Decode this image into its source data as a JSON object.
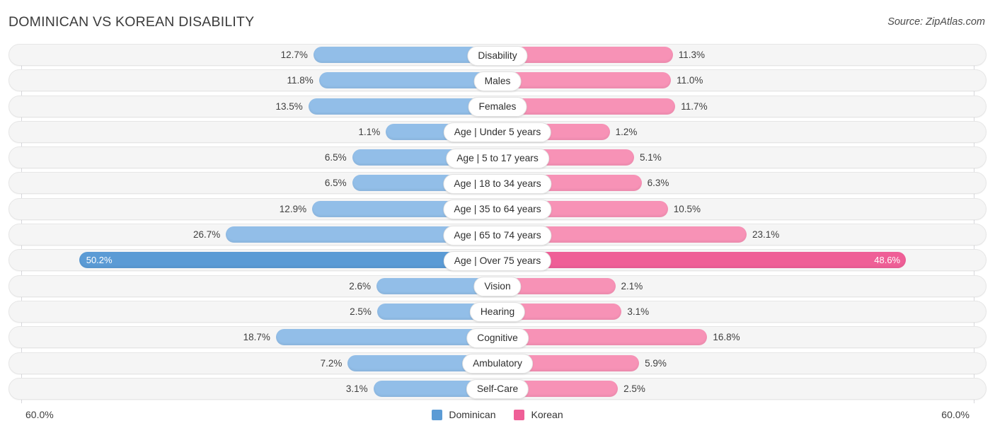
{
  "header": {
    "title": "DOMINICAN VS KOREAN DISABILITY",
    "source": "Source: ZipAtlas.com"
  },
  "footer": {
    "axis_left": "60.0%",
    "axis_right": "60.0%",
    "legend": [
      {
        "label": "Dominican",
        "color": "#5b9bd5"
      },
      {
        "label": "Korean",
        "color": "#ef5f97"
      }
    ]
  },
  "colors": {
    "left_bar": "#92bee8",
    "right_bar": "#f792b6",
    "left_bar_highlight": "#5b9bd5",
    "right_bar_highlight": "#ef5f97",
    "track": "#f5f5f5",
    "title": "#3b3b3b"
  },
  "chart_data": {
    "type": "bar",
    "title": "DOMINICAN VS KOREAN DISABILITY",
    "subtitle": "",
    "orientation": "horizontal-diverging",
    "xlabel": "",
    "ylabel": "",
    "xlim": [
      -60.0,
      60.0
    ],
    "axis_tick_labels": [
      "60.0%",
      "60.0%"
    ],
    "grid": false,
    "legend_position": "bottom-center",
    "series": [
      {
        "name": "Dominican",
        "color": "#5b9bd5",
        "side": "left",
        "values": [
          12.7,
          11.8,
          13.5,
          1.1,
          6.5,
          6.5,
          12.9,
          26.7,
          50.2,
          2.6,
          2.5,
          18.7,
          7.2,
          3.1
        ]
      },
      {
        "name": "Korean",
        "color": "#ef5f97",
        "side": "right",
        "values": [
          11.3,
          11.0,
          11.7,
          1.2,
          5.1,
          6.3,
          10.5,
          23.1,
          48.6,
          2.1,
          3.1,
          16.8,
          5.9,
          2.5
        ]
      }
    ],
    "categories": [
      "Disability",
      "Males",
      "Females",
      "Age | Under 5 years",
      "Age | 5 to 17 years",
      "Age | 18 to 34 years",
      "Age | 35 to 64 years",
      "Age | 65 to 74 years",
      "Age | Over 75 years",
      "Vision",
      "Hearing",
      "Cognitive",
      "Ambulatory",
      "Self-Care"
    ]
  },
  "rows": [
    {
      "label": "Disability",
      "left_value": "12.7%",
      "right_value": "11.3%",
      "left_num": 12.7,
      "right_num": 11.3,
      "highlight": false
    },
    {
      "label": "Males",
      "left_value": "11.8%",
      "right_value": "11.0%",
      "left_num": 11.8,
      "right_num": 11.0,
      "highlight": false
    },
    {
      "label": "Females",
      "left_value": "13.5%",
      "right_value": "11.7%",
      "left_num": 13.5,
      "right_num": 11.7,
      "highlight": false
    },
    {
      "label": "Age | Under 5 years",
      "left_value": "1.1%",
      "right_value": "1.2%",
      "left_num": 1.1,
      "right_num": 1.2,
      "highlight": false
    },
    {
      "label": "Age | 5 to 17 years",
      "left_value": "6.5%",
      "right_value": "5.1%",
      "left_num": 6.5,
      "right_num": 5.1,
      "highlight": false
    },
    {
      "label": "Age | 18 to 34 years",
      "left_value": "6.5%",
      "right_value": "6.3%",
      "left_num": 6.5,
      "right_num": 6.3,
      "highlight": false
    },
    {
      "label": "Age | 35 to 64 years",
      "left_value": "12.9%",
      "right_value": "10.5%",
      "left_num": 12.9,
      "right_num": 10.5,
      "highlight": false
    },
    {
      "label": "Age | 65 to 74 years",
      "left_value": "26.7%",
      "right_value": "23.1%",
      "left_num": 26.7,
      "right_num": 23.1,
      "highlight": false
    },
    {
      "label": "Age | Over 75 years",
      "left_value": "50.2%",
      "right_value": "48.6%",
      "left_num": 50.2,
      "right_num": 48.6,
      "highlight": true
    },
    {
      "label": "Vision",
      "left_value": "2.6%",
      "right_value": "2.1%",
      "left_num": 2.6,
      "right_num": 2.1,
      "highlight": false
    },
    {
      "label": "Hearing",
      "left_value": "2.5%",
      "right_value": "3.1%",
      "left_num": 2.5,
      "right_num": 3.1,
      "highlight": false
    },
    {
      "label": "Cognitive",
      "left_value": "18.7%",
      "right_value": "16.8%",
      "left_num": 18.7,
      "right_num": 16.8,
      "highlight": false
    },
    {
      "label": "Ambulatory",
      "left_value": "7.2%",
      "right_value": "5.9%",
      "left_num": 7.2,
      "right_num": 5.9,
      "highlight": false
    },
    {
      "label": "Self-Care",
      "left_value": "3.1%",
      "right_value": "2.5%",
      "left_num": 3.1,
      "right_num": 2.5,
      "highlight": false
    }
  ]
}
